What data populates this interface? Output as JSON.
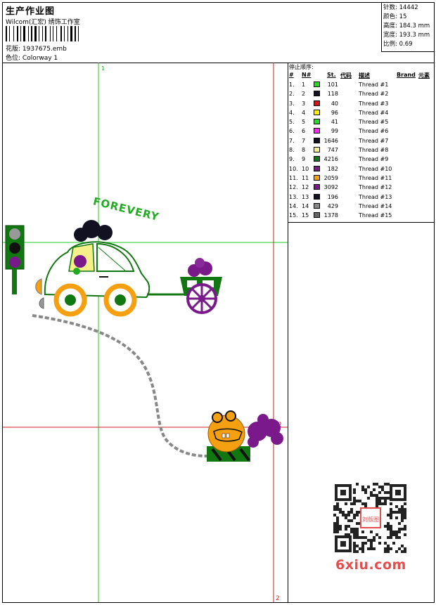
{
  "header": {
    "title": "生产作业图",
    "studio": "Wilcom(汇宏) 绣饰工作室",
    "file_label": "花版:",
    "file_value": "1937675.emb",
    "color_label": "色位:",
    "color_value": "Colorway 1"
  },
  "stats": {
    "stitches_label": "针数:",
    "stitches_value": "14442",
    "colors_label": "颜色:",
    "colors_value": "15",
    "height_label": "高度:",
    "height_value": "184.3 mm",
    "width_label": "宽度:",
    "width_value": "193.3 mm",
    "scale_label": "比例:",
    "scale_value": "0.69"
  },
  "canvas": {
    "marker_top": "1",
    "marker_right": "2",
    "marker_bottom": "2",
    "forever_text": "FOREVERY"
  },
  "thread_table": {
    "title": "停止顺序:",
    "headers": {
      "stop": "#",
      "no": "N#",
      "st": "St.",
      "code": "代码",
      "desc": "描述",
      "brand": "Brand",
      "element": "元素"
    },
    "rows": [
      {
        "stop": "1.",
        "no": "1",
        "color": "#22dd22",
        "st": "101",
        "desc": "Thread #1"
      },
      {
        "stop": "2.",
        "no": "2",
        "color": "#111122",
        "st": "118",
        "desc": "Thread #2"
      },
      {
        "stop": "3.",
        "no": "3",
        "color": "#dd1111",
        "st": "40",
        "desc": "Thread #3"
      },
      {
        "stop": "4.",
        "no": "4",
        "color": "#ffee00",
        "st": "96",
        "desc": "Thread #4"
      },
      {
        "stop": "5.",
        "no": "5",
        "color": "#22dd22",
        "st": "41",
        "desc": "Thread #5"
      },
      {
        "stop": "6.",
        "no": "6",
        "color": "#ff22ff",
        "st": "99",
        "desc": "Thread #6"
      },
      {
        "stop": "7.",
        "no": "7",
        "color": "#111122",
        "st": "1646",
        "desc": "Thread #7"
      },
      {
        "stop": "8.",
        "no": "8",
        "color": "#f5f08a",
        "st": "747",
        "desc": "Thread #8"
      },
      {
        "stop": "9.",
        "no": "9",
        "color": "#117711",
        "st": "4216",
        "desc": "Thread #9"
      },
      {
        "stop": "10.",
        "no": "10",
        "color": "#7a1a8a",
        "st": "182",
        "desc": "Thread #10"
      },
      {
        "stop": "11.",
        "no": "11",
        "color": "#f5a011",
        "st": "2059",
        "desc": "Thread #11"
      },
      {
        "stop": "12.",
        "no": "12",
        "color": "#7a1a8a",
        "st": "3092",
        "desc": "Thread #12"
      },
      {
        "stop": "13.",
        "no": "13",
        "color": "#111122",
        "st": "196",
        "desc": "Thread #13"
      },
      {
        "stop": "14.",
        "no": "14",
        "color": "#888888",
        "st": "429",
        "desc": "Thread #14"
      },
      {
        "stop": "15.",
        "no": "15",
        "color": "#666666",
        "st": "1378",
        "desc": "Thread #15"
      }
    ]
  },
  "watermark": {
    "qr_stamp": "刘版图",
    "brand": "6xiu.com"
  }
}
